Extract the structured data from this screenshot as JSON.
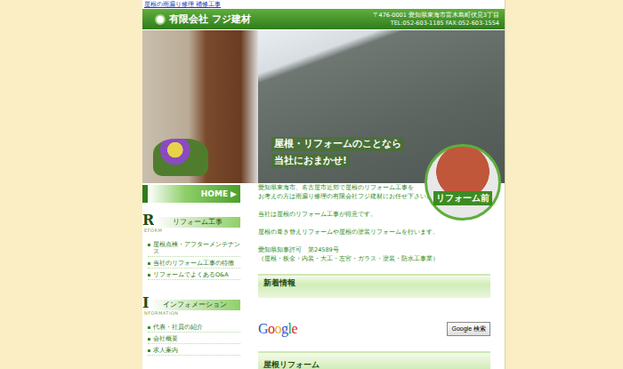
{
  "top_link": "屋根の雨漏り修理 補修工事",
  "header": {
    "company": "有限会社 フジ建材",
    "address": "〒476-0001 愛知県東海市富木島町伏見3丁目",
    "phone": "TEL:052-603-1185 FAX:052-603-1554"
  },
  "hero": {
    "headline": [
      "屋根・リフォームのことなら",
      "当社におまかせ!"
    ],
    "badge": "リフォーム前"
  },
  "sidebar": {
    "home": {
      "label": "HOME",
      "arrow": "▶"
    },
    "sections": [
      {
        "initial": "R",
        "sub": "EFORM",
        "title": "リフォーム工事",
        "items": [
          "屋根点検・アフターメンテナンス",
          "当社のリフォーム工事の特徴",
          "リフォームでよくあるQ&A"
        ]
      },
      {
        "initial": "I",
        "sub": "NFORMATION",
        "title": "インフォメーション",
        "items": [
          "代表・社員の紹介",
          "会社概要",
          "求人案内"
        ]
      }
    ]
  },
  "content": {
    "paragraphs": [
      [
        "愛知県東海市、名古屋市近郊で屋根のリフォーム工事を",
        "お考えの方は雨漏り修理の有限会社フジ建材にお任せ下さい。"
      ],
      [
        "当社は屋根のリフォーム工事が得意です。"
      ],
      [
        "屋根の葺き替えリフォームや屋根の塗装リフォームを行います。"
      ],
      [
        "愛知県知事許可　第24589号",
        "（屋根・板金・内装・大工・左官・ガラス・塗装・防水工事業）"
      ]
    ],
    "news": {
      "title": "新着情報"
    },
    "search": {
      "logo": [
        {
          "char": "G",
          "color": "#2c57c9"
        },
        {
          "char": "o",
          "color": "#d7261e"
        },
        {
          "char": "o",
          "color": "#e9b10c"
        },
        {
          "char": "g",
          "color": "#2c57c9"
        },
        {
          "char": "l",
          "color": "#2e9a34"
        },
        {
          "char": "e",
          "color": "#d7261e"
        }
      ],
      "button": "Google 検索"
    },
    "next_section": "屋根リフォーム"
  }
}
